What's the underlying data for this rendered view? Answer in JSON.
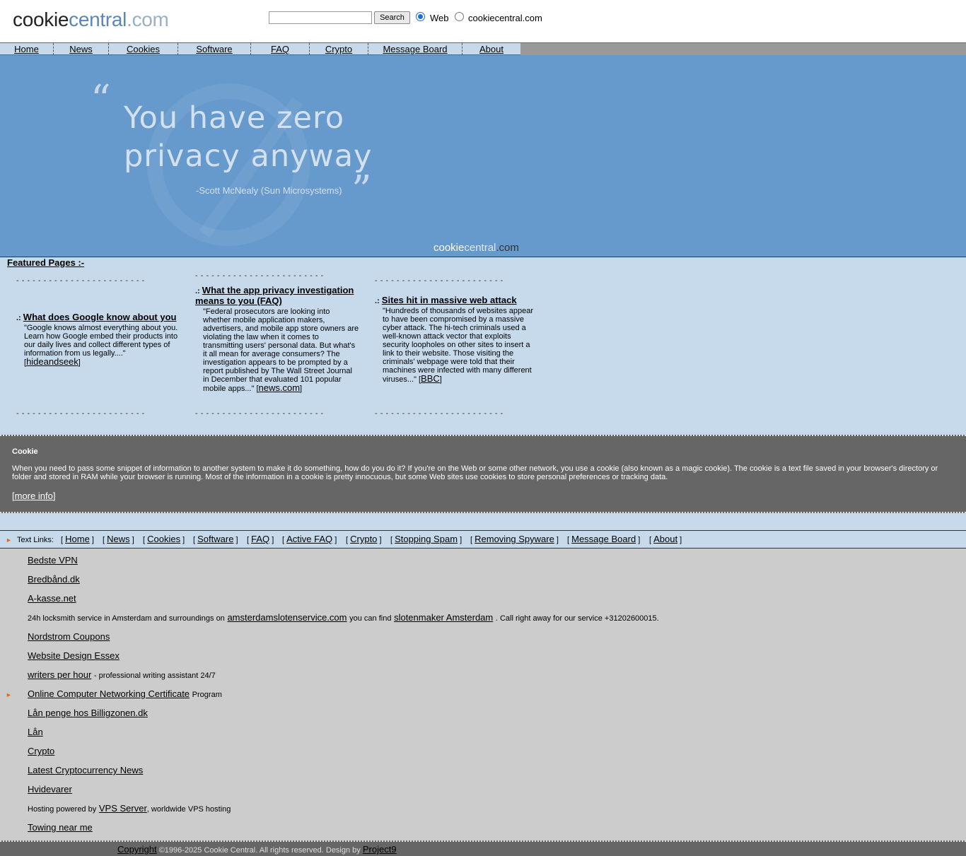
{
  "header": {
    "logo": {
      "part1": "cookie",
      "part2": "central",
      "part3": ".com"
    },
    "search": {
      "placeholder": "",
      "value": "",
      "button_label": "Search"
    },
    "radio_web_label": "Web",
    "radio_site_label": "cookiecentral.com",
    "selected_scope": "Web"
  },
  "nav": {
    "items": [
      {
        "label": "Home"
      },
      {
        "label": "News"
      },
      {
        "label": "Cookies"
      },
      {
        "label": "Software"
      },
      {
        "label": "FAQ"
      },
      {
        "label": "Crypto"
      },
      {
        "label": "Message Board"
      },
      {
        "label": "About"
      }
    ]
  },
  "banner": {
    "quote_open": "“",
    "quote_line1": "You have zero",
    "quote_line2": "privacy anyway",
    "quote_close": "”",
    "author": "-Scott McNealy (Sun Microsystems)",
    "logo_part1": "cookie",
    "logo_part2": "central",
    "logo_part3": ".com"
  },
  "featured": {
    "heading": "Featured Pages :-",
    "dashes": "- - - - - - - - - - - - - - - - - - - - - - - -",
    "marker": ".:",
    "items": [
      {
        "title": "What does Google know about you",
        "description": "\"Google knows almost everything about you. Learn how Google embed their products into our daily lives and collect different types of information from us legally....\"",
        "source": "hideandseek"
      },
      {
        "title": "What the app privacy investigation means to you (FAQ)",
        "description": "\"Federal prosecutors are looking into whether mobile application makers, advertisers, and mobile app store owners are violating the law when it comes to transmitting users' personal data. But what's it all mean for average consumers? The investigation appears to be prompted by a report published by The Wall Street Journal in December that evaluated 101 popular mobile apps...\"",
        "source": "news.com"
      },
      {
        "title": "Sites hit in massive web attack",
        "description": "\"Hundreds of thousands of websites appear to have been compromised by a massive cyber attack. The hi-tech criminals used a well-known attack vector that exploits security loopholes on other sites to insert a link to their website. Those visiting the criminals' webpage were told that their machines were infected with many different viruses...\"",
        "source": "BBC"
      }
    ]
  },
  "cookie_box": {
    "title": "Cookie",
    "text": "When you need to pass some snippet of information to another system to make it do something, how do you do it? If you're on the Web or some other network, you use a cookie (also known as a magic cookie). The cookie is a text file saved in your browser's directory or folder and stored in RAM while your browser is running. Most of the information in a cookie is pretty innocuous, but some Web sites use cookies to store personal preferences or tracking data.",
    "more_link": "more info"
  },
  "text_links": {
    "label": "Text Links:",
    "arrow": "►",
    "items": [
      {
        "label": "Home"
      },
      {
        "label": "News"
      },
      {
        "label": "Cookies"
      },
      {
        "label": "Software"
      },
      {
        "label": "FAQ"
      },
      {
        "label": "Active FAQ"
      },
      {
        "label": "Crypto"
      },
      {
        "label": "Stopping Spam"
      },
      {
        "label": "Removing Spyware"
      },
      {
        "label": "Message Board"
      },
      {
        "label": "About"
      }
    ]
  },
  "sponsors": {
    "bedste_vpn": "Bedste VPN",
    "bredband": "Bredbånd.dk",
    "akasse": "A-kasse.net",
    "locksmith_pre": "24h locksmith service in Amsterdam and surroundings on",
    "locksmith_link1": "amsterdamslotenservice.com",
    "locksmith_mid": "you can find",
    "locksmith_link2": "slotenmaker Amsterdam",
    "locksmith_post": ". Call right away for our service +31202600015.",
    "nordstrom": "Nordstrom Coupons",
    "web_design": "Website Design Essex",
    "writers_link": "writers per hour",
    "writers_post": "- professional writing assistant 24/7",
    "networking_arrow": "►",
    "networking_link": "Online Computer Networking Certificate",
    "networking_post": "Program",
    "laan_penge": "Lån penge hos Billigzonen.dk",
    "laan": "Lån",
    "crypto": "Crypto",
    "crypto_news": "Latest Cryptocurrency News",
    "hvidevarer": "Hvidevarer",
    "hosting_pre": "Hosting powered by",
    "hosting_link": "VPS Server",
    "hosting_post": ", worldwide VPS hosting",
    "towing": "Towing near me"
  },
  "footer": {
    "copyright_link": "Copyright",
    "copyright_text": "©1996-2025 Cookie Central. All rights reserved. Design by",
    "design_link": "Project9"
  },
  "colors": {
    "banner_bg": "#6699cc",
    "light_band": "#c6daec",
    "dark_band": "#666666",
    "sponsor_bg": "#cccccc",
    "accent_arrow": "#e86a10"
  }
}
